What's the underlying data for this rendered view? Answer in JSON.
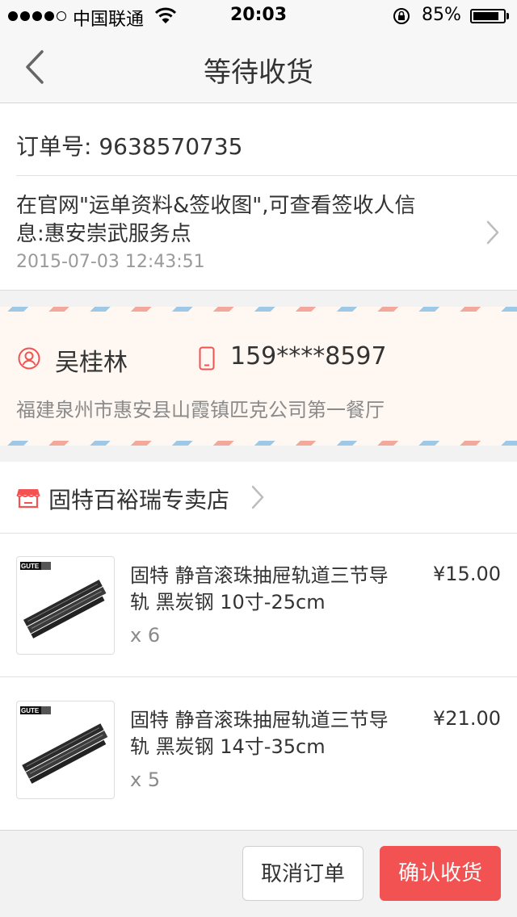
{
  "status_bar": {
    "carrier": "中国联通",
    "time": "20:03",
    "battery_percent": "85%",
    "battery_level": 0.85,
    "signal_bars": 4,
    "signal_max": 5
  },
  "nav": {
    "title": "等待收货",
    "back_icon": "chevron-left-icon"
  },
  "order": {
    "number_label": "订单号: 9638570735",
    "logistics_text": "在官网\"运单资料&签收图\",可查看签收人信息:惠安崇武服务点",
    "logistics_time": "2015-07-03 12:43:51"
  },
  "receiver": {
    "name": "吴桂林",
    "phone": "159****8597",
    "address": "福建泉州市惠安县山霞镇匹克公司第一餐厅"
  },
  "shop": {
    "name": "固特百裕瑞专卖店",
    "products": [
      {
        "title": "固特 静音滚珠抽屉轨道三节导轨 黑炭钢 10寸-25cm",
        "price": "¥15.00",
        "qty": "x 6",
        "brand": "GUTE"
      },
      {
        "title": "固特 静音滚珠抽屉轨道三节导轨 黑炭钢 14寸-35cm",
        "price": "¥21.00",
        "qty": "x 5",
        "brand": "GUTE"
      }
    ]
  },
  "actions": {
    "cancel_label": "取消订单",
    "confirm_label": "确认收货"
  },
  "colors": {
    "accent": "#f25252",
    "address_bg": "#fff8f2",
    "stripe_blue": "#9ec9e6",
    "stripe_red": "#f3a89c"
  }
}
